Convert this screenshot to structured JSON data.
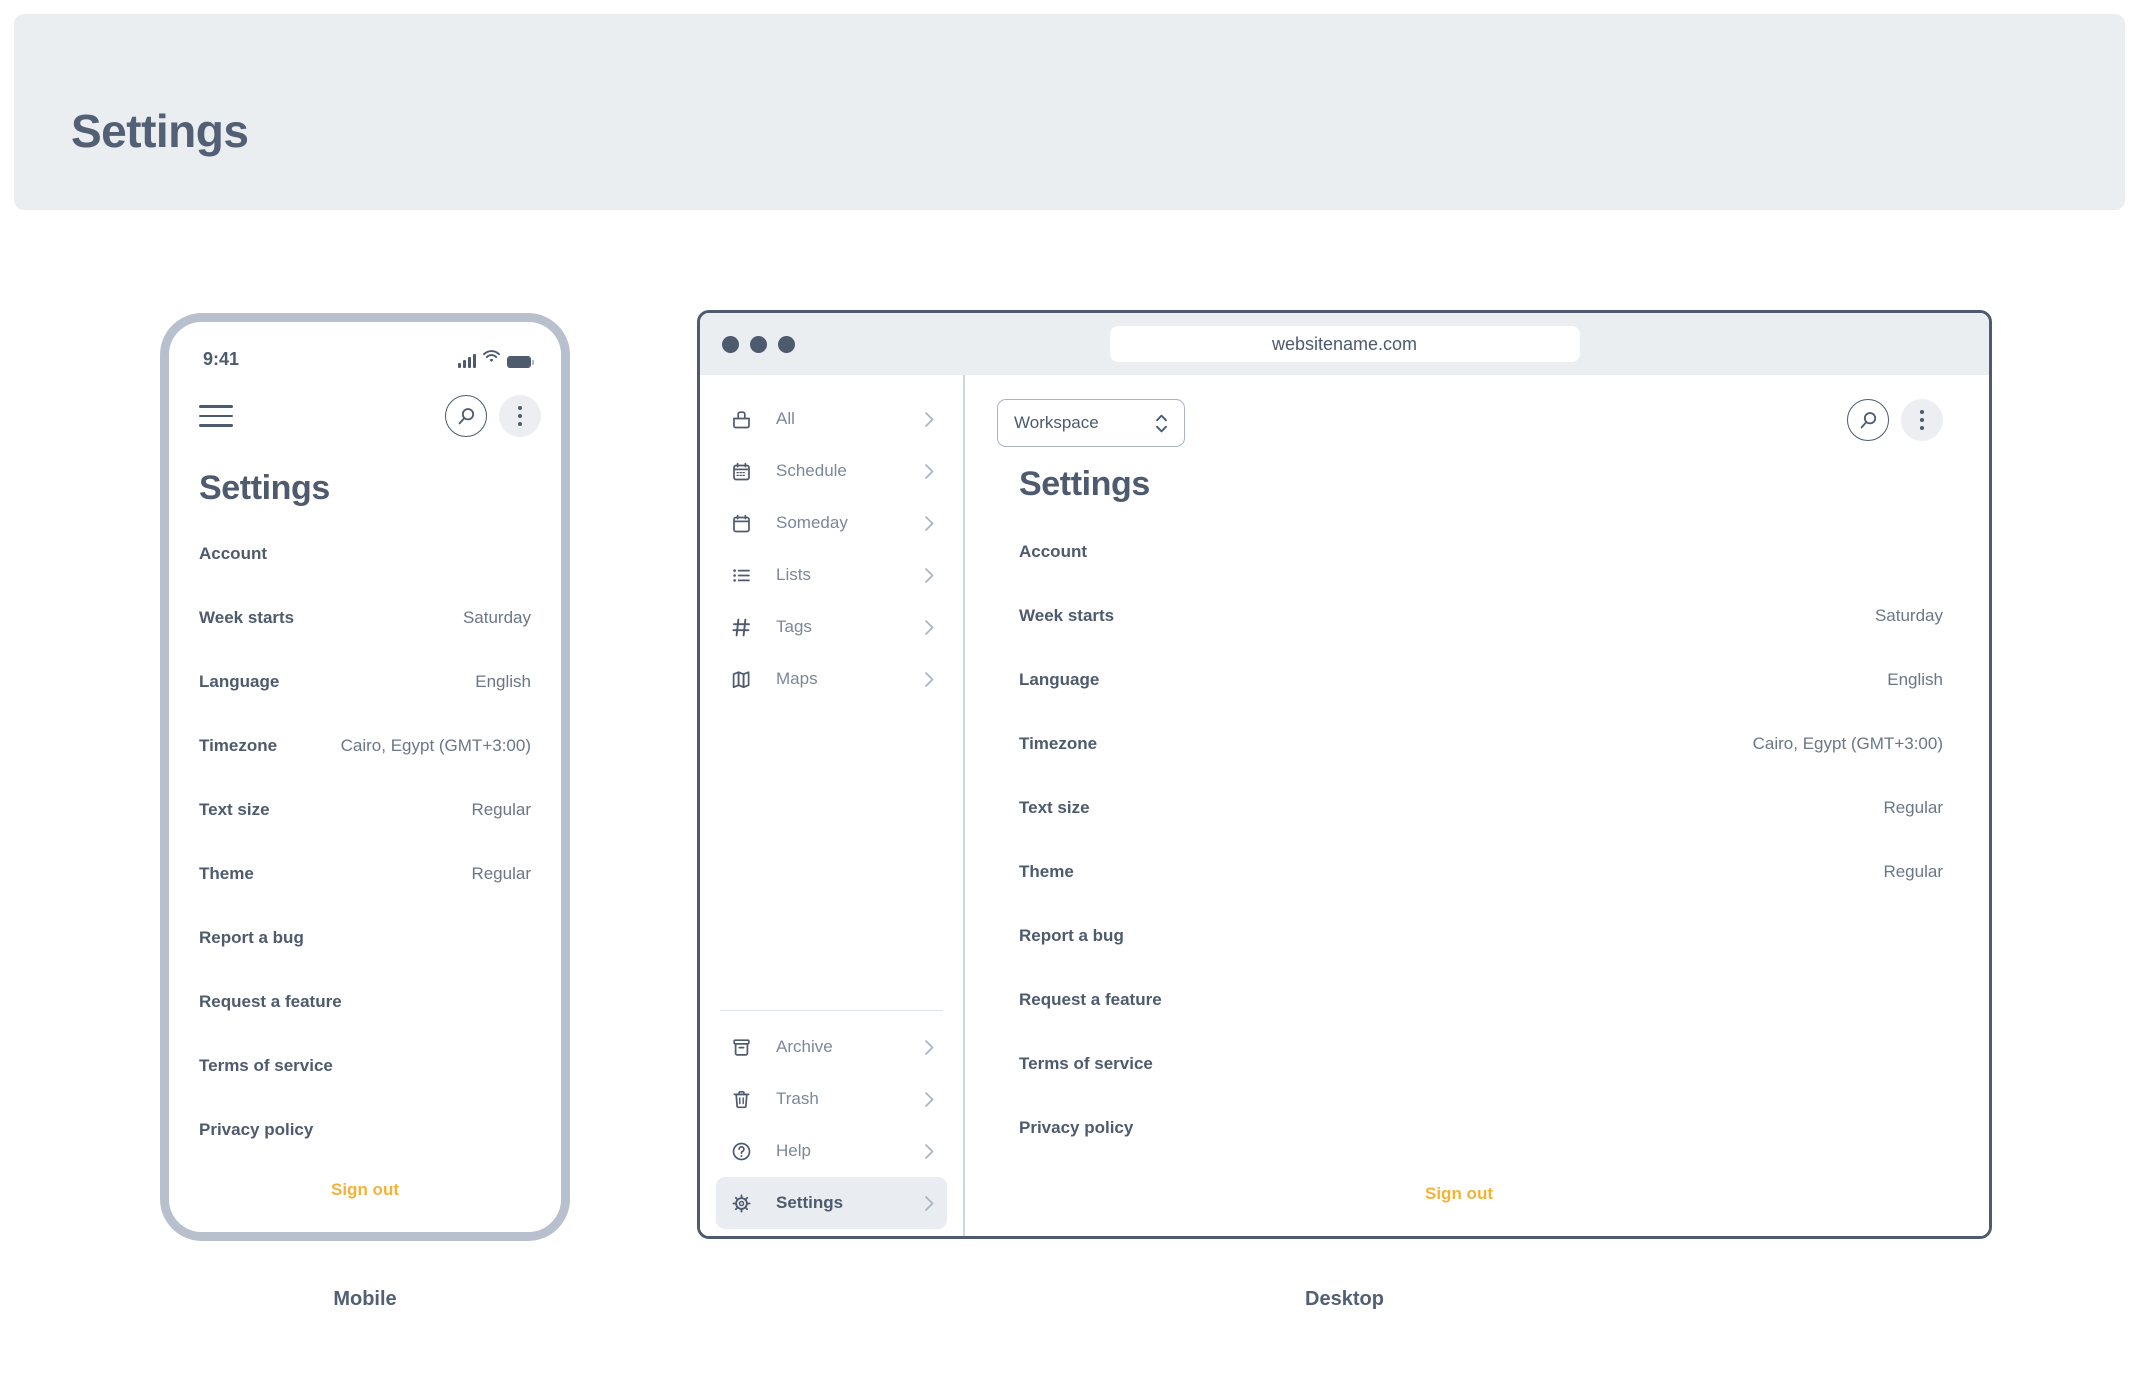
{
  "page": {
    "header_title": "Settings",
    "accent_color": "#f5b335",
    "text_color": "#4e5a6e",
    "muted_color": "#7c8799",
    "banner_bg": "#eaeef1"
  },
  "mobile": {
    "caption": "Mobile",
    "status": {
      "time": "9:41",
      "signal_icon": "signal-bars-icon",
      "wifi_icon": "wifi-icon",
      "battery_icon": "battery-icon"
    },
    "topbar": {
      "menu_icon": "hamburger-menu-icon",
      "search_icon": "search-icon",
      "more_icon": "more-vertical-icon"
    },
    "title": "Settings",
    "rows": [
      {
        "label": "Account",
        "value": ""
      },
      {
        "label": "Week starts",
        "value": "Saturday"
      },
      {
        "label": "Language",
        "value": "English"
      },
      {
        "label": "Timezone",
        "value": "Cairo, Egypt (GMT+3:00)"
      },
      {
        "label": "Text size",
        "value": "Regular"
      },
      {
        "label": "Theme",
        "value": "Regular"
      },
      {
        "label": "Report a bug",
        "value": ""
      },
      {
        "label": "Request a feature",
        "value": ""
      },
      {
        "label": "Terms of service",
        "value": ""
      },
      {
        "label": "Privacy policy",
        "value": ""
      }
    ],
    "sign_out": "Sign out"
  },
  "desktop": {
    "caption": "Desktop",
    "browser": {
      "url": "websitename.com",
      "traffic_lights_icon": "window-controls-icon"
    },
    "sidebar": {
      "primary_items": [
        {
          "label": "All",
          "icon": "inbox-icon"
        },
        {
          "label": "Schedule",
          "icon": "calendar-schedule-icon"
        },
        {
          "label": "Someday",
          "icon": "calendar-icon"
        },
        {
          "label": "Lists",
          "icon": "list-icon"
        },
        {
          "label": "Tags",
          "icon": "hash-icon"
        },
        {
          "label": "Maps",
          "icon": "map-icon"
        }
      ],
      "secondary_items": [
        {
          "label": "Archive",
          "icon": "archive-icon",
          "active": false
        },
        {
          "label": "Trash",
          "icon": "trash-icon",
          "active": false
        },
        {
          "label": "Help",
          "icon": "help-circle-icon",
          "active": false
        },
        {
          "label": "Settings",
          "icon": "gear-icon",
          "active": true
        }
      ]
    },
    "workspace_select": {
      "value": "Workspace",
      "chevron_icon": "chevron-up-down-icon"
    },
    "topbar": {
      "search_icon": "search-icon",
      "more_icon": "more-vertical-icon"
    },
    "title": "Settings",
    "rows": [
      {
        "label": "Account",
        "value": ""
      },
      {
        "label": "Week starts",
        "value": "Saturday"
      },
      {
        "label": "Language",
        "value": "English"
      },
      {
        "label": "Timezone",
        "value": "Cairo, Egypt (GMT+3:00)"
      },
      {
        "label": "Text size",
        "value": "Regular"
      },
      {
        "label": "Theme",
        "value": "Regular"
      },
      {
        "label": "Report a bug",
        "value": ""
      },
      {
        "label": "Request a feature",
        "value": ""
      },
      {
        "label": "Terms of service",
        "value": ""
      },
      {
        "label": "Privacy policy",
        "value": ""
      }
    ],
    "sign_out": "Sign out"
  }
}
